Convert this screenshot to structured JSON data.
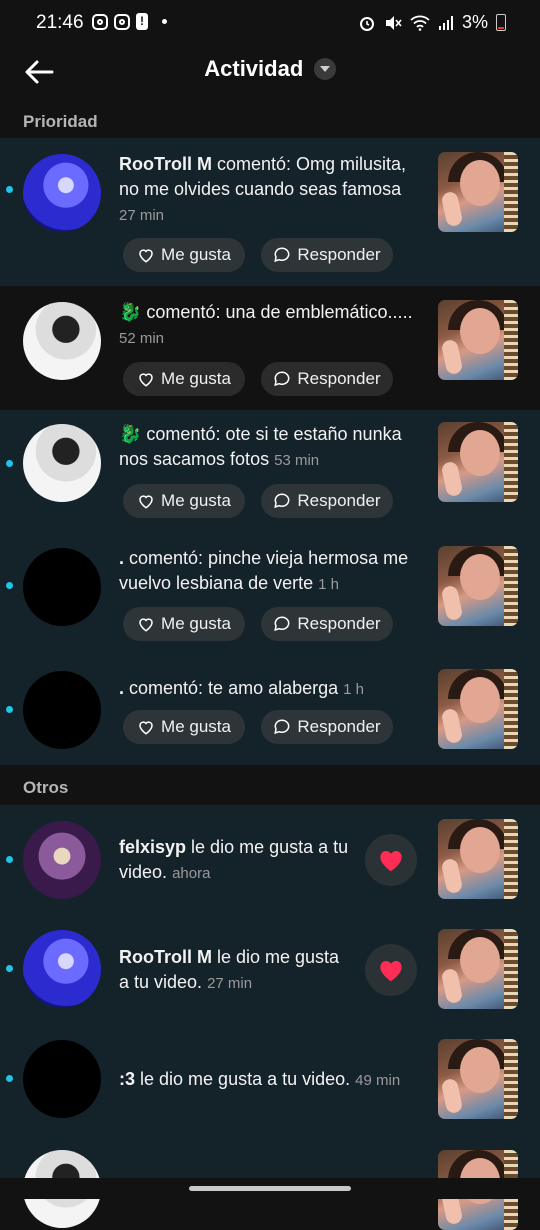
{
  "status_bar": {
    "time": "21:46",
    "battery": "3%"
  },
  "header": {
    "title": "Actividad"
  },
  "sections": {
    "priority": "Prioridad",
    "others": "Otros"
  },
  "buttons": {
    "like": "Me gusta",
    "reply": "Responder"
  },
  "priority_items": [
    {
      "user": "RooTroll M",
      "action": " comentó: Omg milusita, no me olvides cuando seas famosa",
      "time": "27 min"
    },
    {
      "user": "🐉",
      "action": " comentó: una de emblemático.....",
      "time": "52 min"
    },
    {
      "user": "🐉",
      "action": " comentó: ote si te estaño nunka nos sacamos fotos",
      "time": "53 min"
    },
    {
      "user": ".",
      "action": " comentó: pinche vieja hermosa me vuelvo lesbiana de verte",
      "time": "1 h"
    },
    {
      "user": ".",
      "action": " comentó: te amo alaberga",
      "time": "1 h"
    }
  ],
  "other_items": [
    {
      "user": "felxisyp",
      "action": " le dio me gusta a tu video.",
      "time": "ahora"
    },
    {
      "user": "RooTroll M",
      "action": " le dio me gusta a tu video.",
      "time": "27 min"
    },
    {
      "user": ":3",
      "action": " le dio me gusta a tu video.",
      "time": "49 min"
    }
  ],
  "colors": {
    "unread_bg": "#14222a",
    "unread_dot": "#20c4e8",
    "heart": "#ff2d55"
  },
  "icons": [
    "back-arrow-icon",
    "dropdown-caret-icon",
    "heart-outline-icon",
    "comment-bubble-icon",
    "heart-filled-icon"
  ]
}
